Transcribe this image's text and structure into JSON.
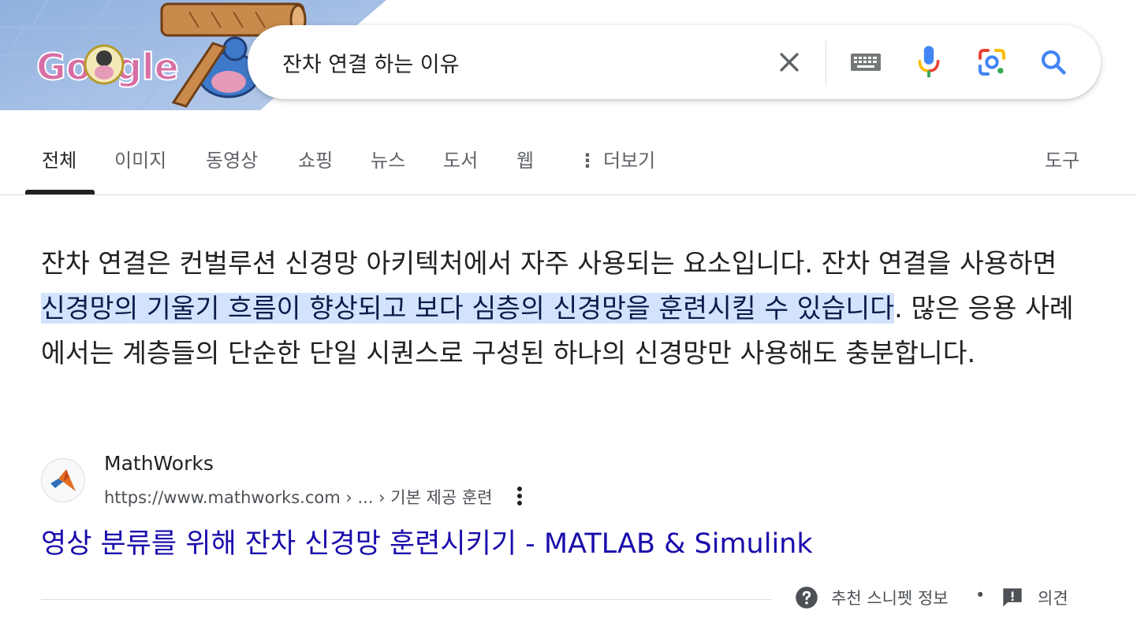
{
  "search": {
    "query": "잔차 연결 하는 이유",
    "logo_text": "Google"
  },
  "tabs": [
    {
      "label": "전체"
    },
    {
      "label": "이미지"
    },
    {
      "label": "동영상"
    },
    {
      "label": "쇼핑"
    },
    {
      "label": "뉴스"
    },
    {
      "label": "도서"
    },
    {
      "label": "웹"
    },
    {
      "label": "더보기"
    }
  ],
  "tools_label": "도구",
  "snippet": {
    "before": "잔차 연결은 컨벌루션 신경망 아키텍처에서 자주 사용되는 요소입니다. 잔차 연결을 사용하면 ",
    "highlight": "신경망의 기울기 흐름이 향상되고 보다 심층의 신경망을 훈련시킬 수 있습니다",
    "after": ". 많은 응용 사례에서는 계층들의 단순한 단일 시퀀스로 구성된 하나의 신경망만 사용해도 충분합니다."
  },
  "source": {
    "site_name": "MathWorks",
    "breadcrumb": "https://www.mathworks.com › ... › 기본 제공 훈련",
    "title": "영상 분류를 위해 잔차 신경망 훈련시키기 - MATLAB & Simulink"
  },
  "footer": {
    "about_label": "추천 스니펫 정보",
    "separator": "•",
    "feedback_label": "의견"
  },
  "colors": {
    "link": "#1a0dab",
    "highlight_bg": "#d3e3fd",
    "google_blue": "#4285f4",
    "google_red": "#ea4335",
    "google_yellow": "#fbbc04",
    "google_green": "#34a853"
  }
}
